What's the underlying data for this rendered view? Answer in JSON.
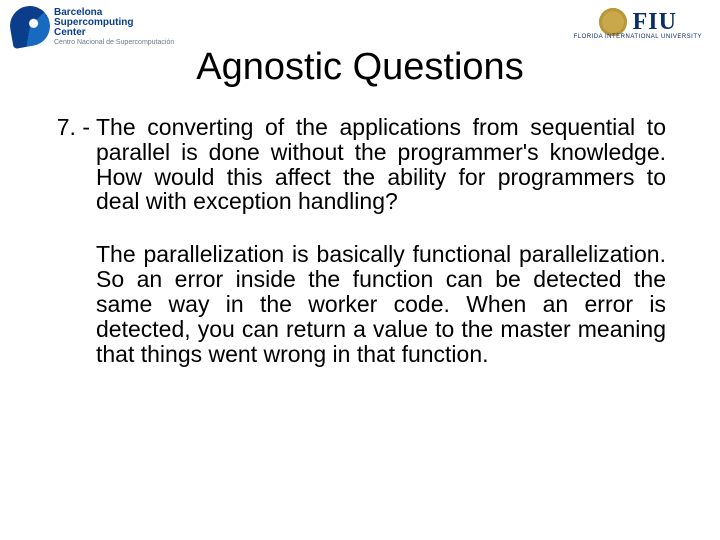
{
  "header": {
    "left_logo": {
      "line1": "Barcelona",
      "line2": "Supercomputing",
      "line3": "Center",
      "line4": "Centro Nacional de Supercomputación"
    },
    "right_logo": {
      "abbrev": "FIU",
      "full": "FLORIDA INTERNATIONAL UNIVERSITY"
    }
  },
  "title": "Agnostic Questions",
  "item": {
    "number": "7. -",
    "question": "The converting of the applications from sequential to parallel is done without the programmer's knowledge.  How would this affect the ability for programmers to deal with exception handling?",
    "answer": "The parallelization is basically functional parallelization. So an error inside the function can be detected the same way in the worker code. When an error is detected, you can return a value to the master meaning that things went wrong in that function."
  }
}
